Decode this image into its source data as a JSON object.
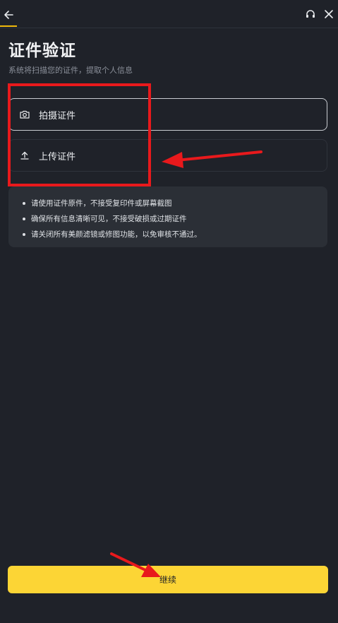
{
  "header": {
    "back_icon": "arrow-left-icon",
    "support_icon": "headset-icon",
    "close_icon": "close-icon",
    "accent_color": "#f0b90b"
  },
  "page": {
    "title": "证件验证",
    "subtitle": "系统将扫描您的证件，提取个人信息"
  },
  "options": [
    {
      "icon": "camera-icon",
      "label": "拍摄证件"
    },
    {
      "icon": "upload-icon",
      "label": "上传证件"
    }
  ],
  "tips": [
    "请使用证件原件，不接受复印件或屏幕截图",
    "确保所有信息清晰可见，不接受破损或过期证件",
    "请关闭所有美颜滤镜或修图功能，以免审核不通过。"
  ],
  "footer": {
    "continue_label": "继续",
    "button_color": "#fcd535"
  },
  "annotations": {
    "color": "#e8191c"
  }
}
